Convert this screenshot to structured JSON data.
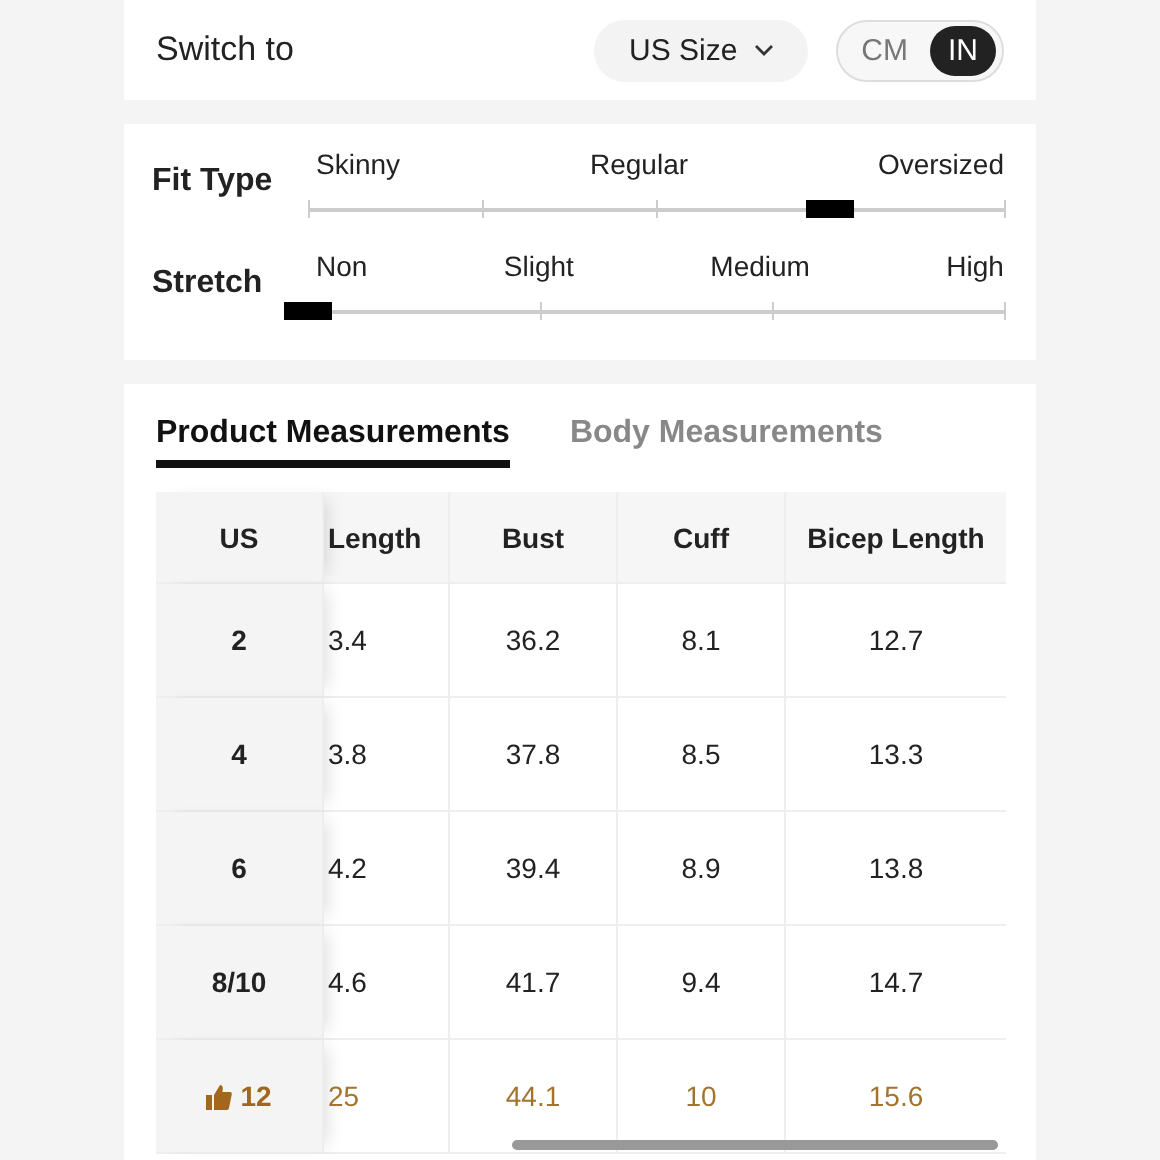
{
  "switch": {
    "label": "Switch to",
    "size_select": "US Size",
    "units": [
      {
        "label": "CM",
        "selected": false
      },
      {
        "label": "IN",
        "selected": true
      }
    ]
  },
  "fit": [
    {
      "name": "Fit Type",
      "kind": "half_steps",
      "labels": [
        "Skinny",
        "Regular",
        "Oversized"
      ],
      "level": 0.75
    },
    {
      "name": "Stretch",
      "kind": "steps",
      "labels": [
        "Non",
        "Slight",
        "Medium",
        "High"
      ]
    }
  ],
  "tabs": [
    {
      "label": "Product Measurements",
      "selected": true
    },
    {
      "label": "Body Measurements",
      "selected": false
    }
  ],
  "table": {
    "columns": [
      "US",
      "Length",
      "Bust",
      "Cuff",
      "Bicep Length"
    ],
    "rows": [
      {
        "cells": [
          "2",
          "3.4",
          "36.2",
          "8.1",
          "12.7"
        ],
        "recommended": false
      },
      {
        "cells": [
          "4",
          "3.8",
          "37.8",
          "8.5",
          "13.3"
        ],
        "recommended": false
      },
      {
        "cells": [
          "6",
          "4.2",
          "39.4",
          "8.9",
          "13.8"
        ],
        "recommended": false
      },
      {
        "cells": [
          "8/10",
          "4.6",
          "41.7",
          "9.4",
          "14.7"
        ],
        "recommended": false
      },
      {
        "cells": [
          "12",
          "25",
          "44.1",
          "10",
          "15.6"
        ],
        "recommended": true
      }
    ]
  }
}
